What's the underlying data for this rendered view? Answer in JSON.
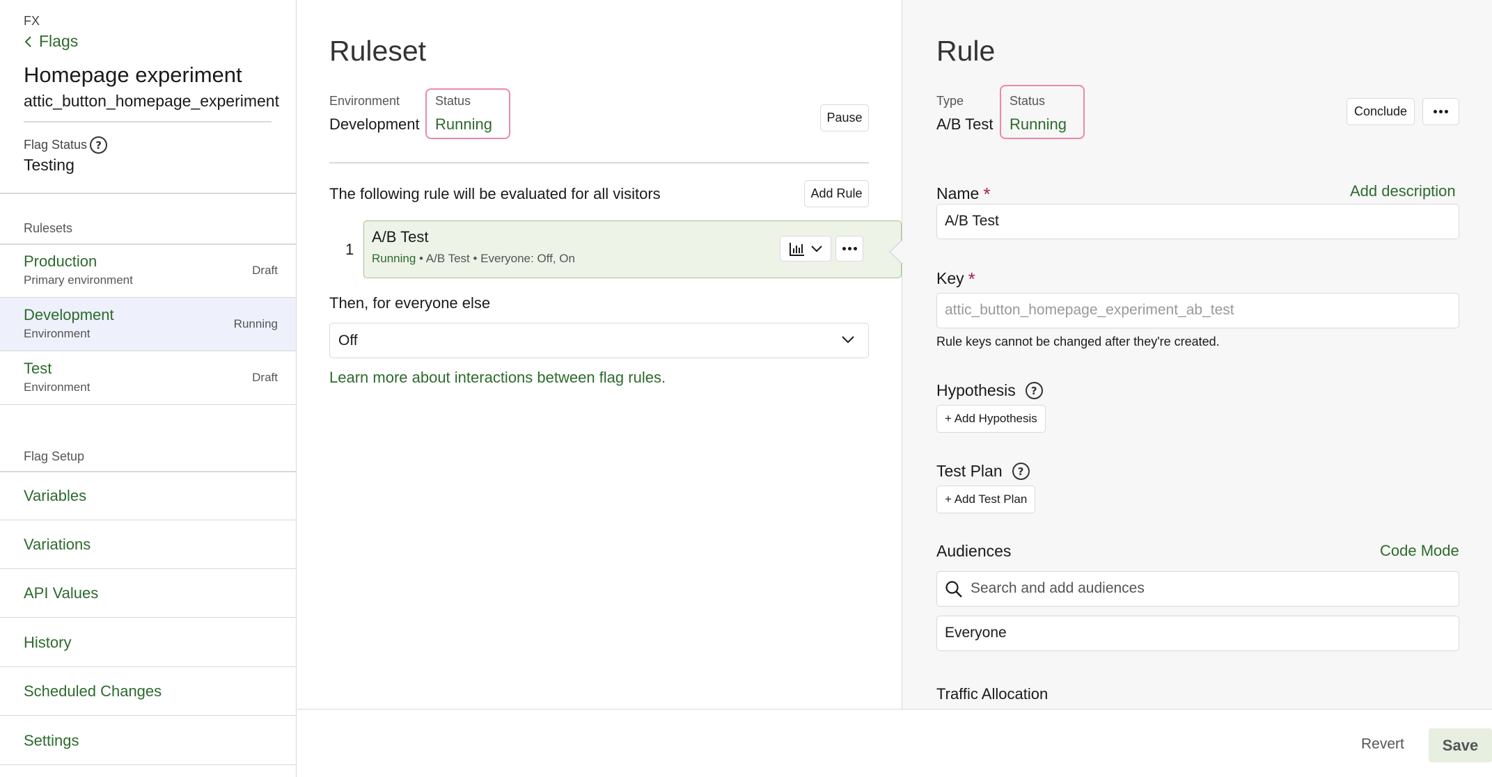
{
  "sidebar": {
    "crumb_top": "FX",
    "back_label": "Flags",
    "flag_name": "Homepage experiment",
    "flag_key": "attic_button_homepage_experiment",
    "flag_status_label": "Flag Status",
    "flag_status_value": "Testing",
    "rulesets_label": "Rulesets",
    "rulesets": [
      {
        "name": "Production",
        "sub": "Primary environment",
        "status": "Draft"
      },
      {
        "name": "Development",
        "sub": "Environment",
        "status": "Running"
      },
      {
        "name": "Test",
        "sub": "Environment",
        "status": "Draft"
      }
    ],
    "setup_label": "Flag Setup",
    "setup_items": [
      "Variables",
      "Variations",
      "API Values",
      "History",
      "Scheduled Changes",
      "Settings"
    ]
  },
  "ruleset": {
    "title": "Ruleset",
    "environment_label": "Environment",
    "environment_value": "Development",
    "status_label": "Status",
    "status_value": "Running",
    "pause_label": "Pause",
    "evaluated_text": "The following rule will be evaluated for all visitors",
    "add_rule_label": "Add Rule",
    "rule_number": "1",
    "rule": {
      "title": "A/B Test",
      "status": "Running",
      "meta": " • A/B Test • Everyone: Off, On"
    },
    "everyone_else_label": "Then, for everyone else",
    "everyone_else_value": "Off",
    "learn_more": "Learn more about interactions between flag rules."
  },
  "rule": {
    "title": "Rule",
    "type_label": "Type",
    "type_value": "A/B Test",
    "status_label": "Status",
    "status_value": "Running",
    "conclude_label": "Conclude",
    "name_label": "Name",
    "add_description": "Add description",
    "name_value": "A/B Test",
    "key_label": "Key",
    "key_value": "attic_button_homepage_experiment_ab_test",
    "key_help": "Rule keys cannot be changed after they're created.",
    "hypothesis_label": "Hypothesis",
    "add_hypothesis": "+ Add Hypothesis",
    "test_plan_label": "Test Plan",
    "add_test_plan": "+ Add Test Plan",
    "audiences_label": "Audiences",
    "code_mode": "Code Mode",
    "audience_search_placeholder": "Search and add audiences",
    "audience_value": "Everyone",
    "traffic_label": "Traffic Allocation"
  },
  "footer": {
    "revert_label": "Revert",
    "save_label": "Save"
  },
  "colors": {
    "link_green": "#2d6a2d",
    "status_highlight": "#e88aa8",
    "required": "#a8204f",
    "active_row": "#eef0fb",
    "rule_card_bg": "#eef3e8"
  }
}
